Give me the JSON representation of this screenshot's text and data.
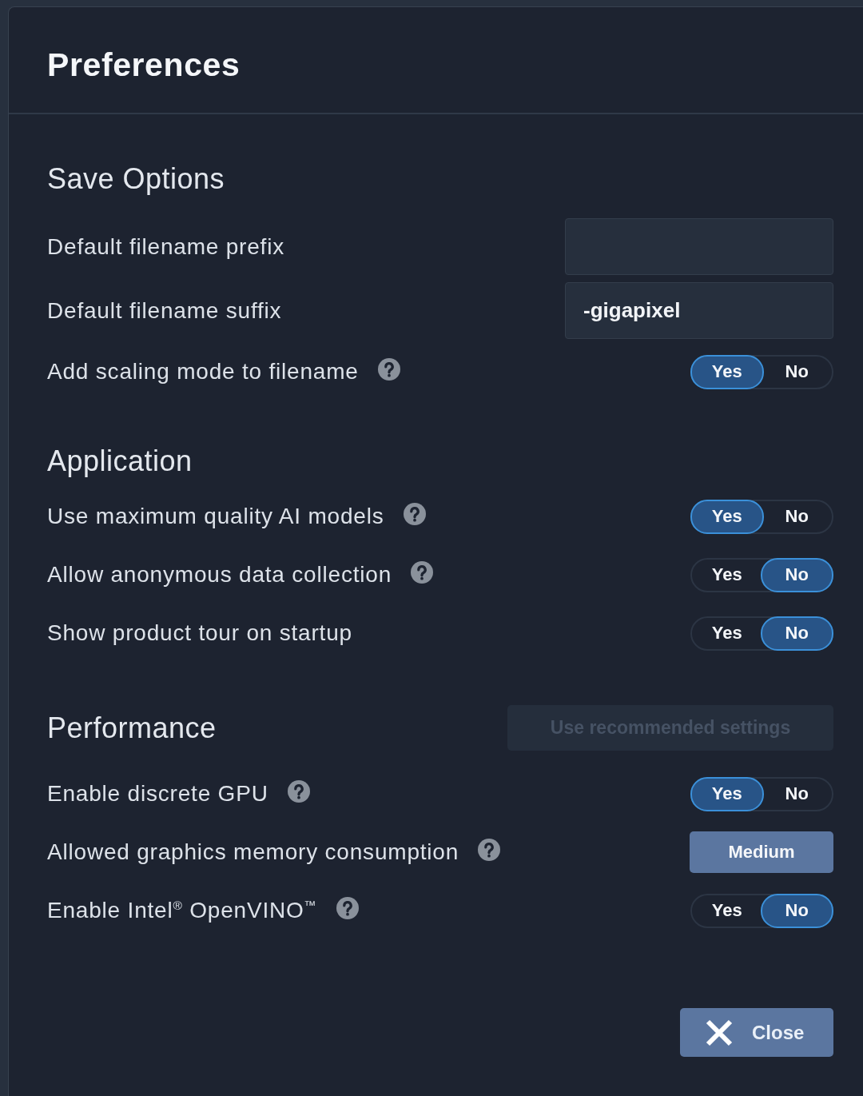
{
  "dialog": {
    "title": "Preferences",
    "sections": [
      {
        "heading": "Save Options",
        "rows": [
          {
            "kind": "input",
            "label": "Default filename prefix",
            "help": false
          },
          {
            "kind": "input",
            "label": "Default filename suffix",
            "value": "-gigapixel",
            "help": false
          },
          {
            "kind": "toggle",
            "label": "Add scaling mode to filename",
            "help": true,
            "options": [
              {
                "label": "Yes",
                "selected": true
              },
              {
                "label": "No",
                "selected": false
              }
            ]
          }
        ]
      },
      {
        "heading": "Application",
        "rows": [
          {
            "kind": "toggle",
            "label": "Use maximum quality AI models",
            "help": true,
            "options": [
              {
                "label": "Yes",
                "selected": true
              },
              {
                "label": "No",
                "selected": false
              }
            ]
          },
          {
            "kind": "toggle",
            "label": "Allow anonymous data collection",
            "help": true,
            "options": [
              {
                "label": "Yes",
                "selected": false
              },
              {
                "label": "No",
                "selected": true
              }
            ]
          },
          {
            "kind": "toggle",
            "label": "Show product tour on startup",
            "help": false,
            "options": [
              {
                "label": "Yes",
                "selected": false
              },
              {
                "label": "No",
                "selected": true
              }
            ]
          }
        ]
      },
      {
        "heading": "Performance",
        "action": {
          "label": "Use recommended settings",
          "disabled": true
        },
        "rows": [
          {
            "kind": "toggle",
            "label": "Enable discrete GPU",
            "help": true,
            "options": [
              {
                "label": "Yes",
                "selected": true
              },
              {
                "label": "No",
                "selected": false
              }
            ]
          },
          {
            "kind": "select",
            "label": "Allowed graphics memory consumption",
            "help": true,
            "value": "Medium"
          },
          {
            "kind": "toggle",
            "label": "Enable Intel$^{®}$ OpenVINO$^{™}$",
            "help": true,
            "options": [
              {
                "label": "Yes",
                "selected": false
              },
              {
                "label": "No",
                "selected": true
              }
            ]
          }
        ]
      }
    ],
    "close_button": {
      "label": "Close"
    }
  }
}
